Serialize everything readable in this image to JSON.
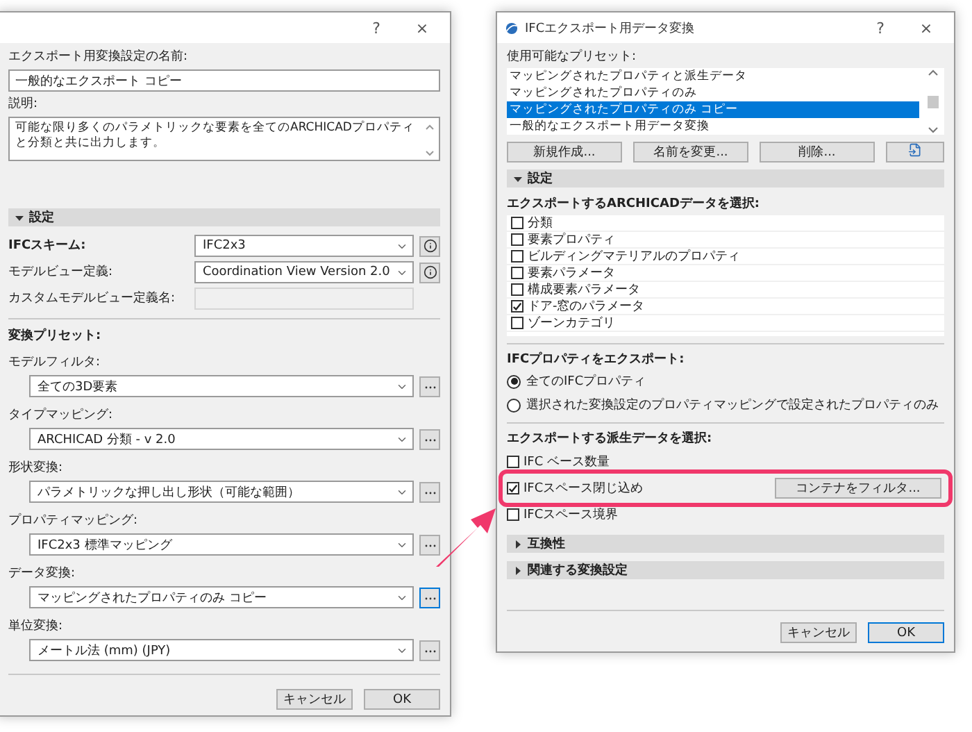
{
  "left_dialog": {
    "title_buttons": [
      "?",
      "×"
    ],
    "name_label": "エクスポート用変換設定の名前:",
    "name_value": "一般的なエクスポート コピー",
    "description_label": "説明:",
    "description_value": "可能な限り多くのパラメトリックな要素を全てのARCHICADプロパティと分類と共に出力します。",
    "settings_section": {
      "label": "設定",
      "expanded": true
    },
    "scheme": {
      "label": "IFCスキーム:",
      "value": "IFC2x3"
    },
    "model_view": {
      "label": "モデルビュー定義:",
      "value": "Coordination View Version 2.0"
    },
    "custom_view": {
      "label": "カスタムモデルビュー定義名:"
    },
    "preset_heading": "変換プリセット:",
    "presets": [
      {
        "label": "モデルフィルタ:",
        "value": "全ての3D要素",
        "focused": false
      },
      {
        "label": "タイプマッピング:",
        "value": "ARCHICAD 分類 - v 2.0",
        "focused": false
      },
      {
        "label": "形状変換:",
        "value": "パラメトリックな押し出し形状（可能な範囲）",
        "focused": false
      },
      {
        "label": "プロパティマッピング:",
        "value": "IFC2x3 標準マッピング",
        "focused": false
      },
      {
        "label": "データ変換:",
        "value": "マッピングされたプロパティのみ コピー",
        "focused": true
      },
      {
        "label": "単位変換:",
        "value": "メートル法 (mm) (JPY)",
        "focused": false
      }
    ],
    "buttons": [
      {
        "label": "キャンセル",
        "default": false
      },
      {
        "label": "OK",
        "default": false
      }
    ]
  },
  "right_dialog": {
    "title": "IFCエクスポート用データ変換",
    "title_buttons": [
      "?",
      "×"
    ],
    "presets_label": "使用可能なプリセット:",
    "presets": [
      {
        "label": "マッピングされたプロパティと派生データ",
        "selected": false
      },
      {
        "label": "マッピングされたプロパティのみ",
        "selected": false
      },
      {
        "label": "マッピングされたプロパティのみ コピー",
        "selected": true
      },
      {
        "label": "一般的なエクスポート用データ変換",
        "selected": false
      }
    ],
    "preset_buttons": [
      "新規作成...",
      "名前を変更...",
      "削除..."
    ],
    "settings_section": {
      "label": "設定",
      "expanded": true
    },
    "data_label": "エクスポートするARCHICADデータを選択:",
    "data_items": [
      {
        "label": "分類",
        "checked": false
      },
      {
        "label": "要素プロパティ",
        "checked": false
      },
      {
        "label": "ビルディングマテリアルのプロパティ",
        "checked": false
      },
      {
        "label": "要素パラメータ",
        "checked": false
      },
      {
        "label": "構成要素パラメータ",
        "checked": false
      },
      {
        "label": "ドア-窓のパラメータ",
        "checked": true
      },
      {
        "label": "ゾーンカテゴリ",
        "checked": false
      }
    ],
    "properties_label": "IFCプロパティをエクスポート:",
    "property_options": [
      {
        "label": "全てのIFCプロパティ",
        "selected": true
      },
      {
        "label": "選択された変換設定のプロパティマッピングで設定されたプロパティのみ",
        "selected": false
      }
    ],
    "derived_label": "エクスポートする派生データを選択:",
    "derived_items": [
      {
        "label": "IFC ベース数量",
        "checked": false,
        "highlighted": false
      },
      {
        "label": "IFCスペース閉じ込め",
        "checked": true,
        "highlighted": true,
        "button": "コンテナをフィルタ..."
      },
      {
        "label": "IFCスペース境界",
        "checked": false,
        "highlighted": false
      }
    ],
    "collapsed_sections": [
      {
        "label": "互換性",
        "expanded": false
      },
      {
        "label": "関連する変換設定",
        "expanded": false
      }
    ],
    "buttons": [
      {
        "label": "キャンセル",
        "default": false
      },
      {
        "label": "OK",
        "default": true
      }
    ]
  }
}
